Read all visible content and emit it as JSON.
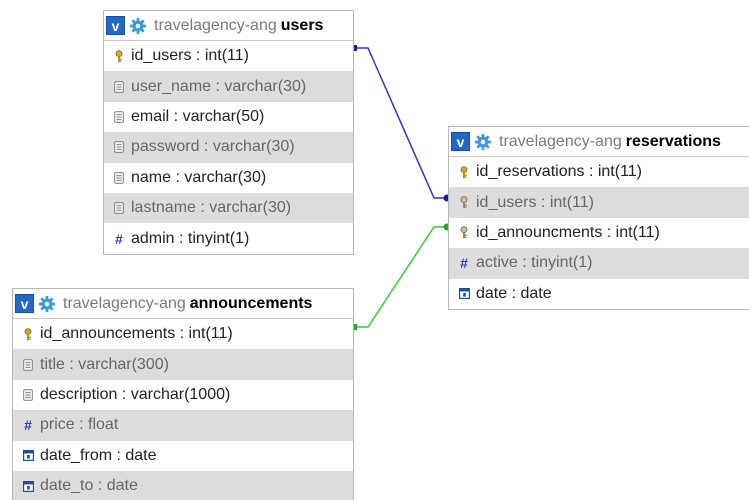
{
  "database": "travelagency-ang",
  "colors": {
    "accent_blue": "#2367c7",
    "gear_blue": "#3b9ad9",
    "link_users": "#3333cc",
    "link_announcements": "#33cc33",
    "row_alt_bg": "#dcdcdc"
  },
  "tables": {
    "users": {
      "name": "users",
      "fields": [
        {
          "label": "id_users : int(11)",
          "icon": "primary-key-icon"
        },
        {
          "label": "user_name : varchar(30)",
          "icon": "text-field-icon"
        },
        {
          "label": "email : varchar(50)",
          "icon": "text-field-icon"
        },
        {
          "label": "password : varchar(30)",
          "icon": "text-field-icon"
        },
        {
          "label": "name : varchar(30)",
          "icon": "text-field-icon"
        },
        {
          "label": "lastname : varchar(30)",
          "icon": "text-field-icon"
        },
        {
          "label": "admin : tinyint(1)",
          "icon": "number-field-icon"
        }
      ]
    },
    "reservations": {
      "name": "reservations",
      "fields": [
        {
          "label": "id_reservations : int(11)",
          "icon": "primary-key-icon"
        },
        {
          "label": "id_users : int(11)",
          "icon": "key-icon"
        },
        {
          "label": "id_announcments : int(11)",
          "icon": "key-icon"
        },
        {
          "label": "active : tinyint(1)",
          "icon": "number-field-icon"
        },
        {
          "label": "date : date",
          "icon": "date-field-icon"
        }
      ]
    },
    "announcements": {
      "name": "announcements",
      "fields": [
        {
          "label": "id_announcements : int(11)",
          "icon": "primary-key-icon"
        },
        {
          "label": "title : varchar(300)",
          "icon": "text-field-icon"
        },
        {
          "label": "description : varchar(1000)",
          "icon": "text-field-icon"
        },
        {
          "label": "price : float",
          "icon": "number-field-icon"
        },
        {
          "label": "date_from : date",
          "icon": "date-field-icon"
        },
        {
          "label": "date_to : date",
          "icon": "date-field-icon"
        }
      ]
    }
  }
}
